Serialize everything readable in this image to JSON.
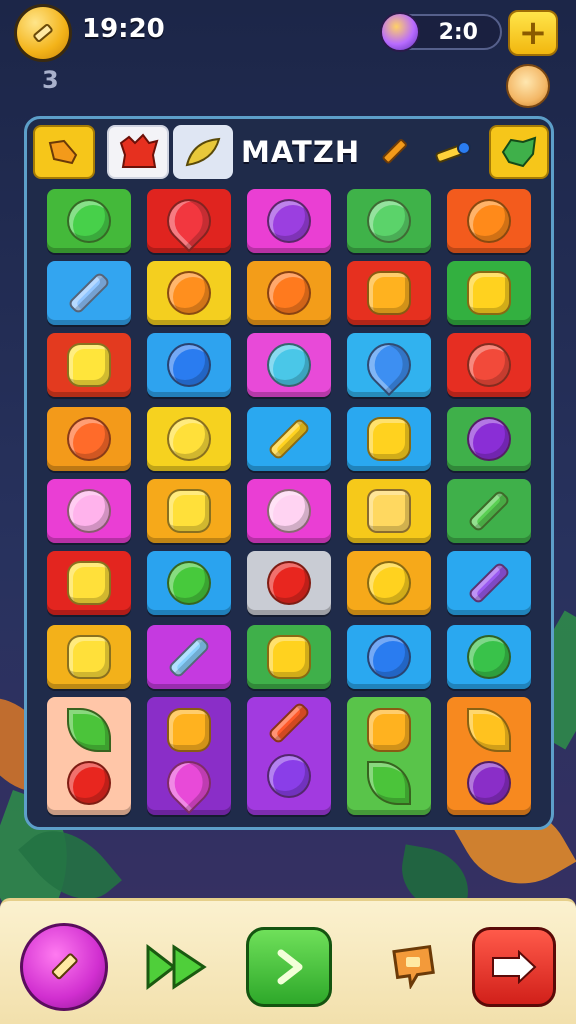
{
  "hud": {
    "time": "19:20",
    "level": "3",
    "score": "2:0",
    "plus_label": "+"
  },
  "board": {
    "title": "MATZH",
    "tab_icons": [
      "boot-icon",
      "red-monster-icon",
      "leaf-icon",
      "pencil-icon",
      "telescope-icon",
      "green-leaf-icon"
    ],
    "rows": [
      [
        {
          "bg": "#44b93a",
          "icon": "green-ball-icon",
          "c": "#47d04a"
        },
        {
          "bg": "#e0241f",
          "icon": "heart-icon",
          "c": "#f2373f"
        },
        {
          "bg": "#ea3fd3",
          "icon": "planet-icon",
          "c": "#9b3fe0"
        },
        {
          "bg": "#3fb249",
          "icon": "green-creature-icon",
          "c": "#5bd36a"
        },
        {
          "bg": "#f35b1d",
          "icon": "orange-icon",
          "c": "#ff8a1a"
        }
      ],
      [
        {
          "bg": "#33a5f0",
          "icon": "potion-icon",
          "c": "#8fc5ff"
        },
        {
          "bg": "#f4cf1f",
          "icon": "orange-icon",
          "c": "#ff8f1e"
        },
        {
          "bg": "#f39d19",
          "icon": "orange-icon",
          "c": "#ff7a1e"
        },
        {
          "bg": "#e6301f",
          "icon": "sun-face-icon",
          "c": "#ffb21f"
        },
        {
          "bg": "#33b040",
          "icon": "star-burst-icon",
          "c": "#ffd21f"
        }
      ],
      [
        {
          "bg": "#e33a1f",
          "icon": "star-face-icon",
          "c": "#ffe53b"
        },
        {
          "bg": "#2ea3ef",
          "icon": "blue-ball-icon",
          "c": "#2a7cf0"
        },
        {
          "bg": "#e84ad8",
          "icon": "teapot-icon",
          "c": "#4ac7e8"
        },
        {
          "bg": "#31b2ef",
          "icon": "blue-heart-icon",
          "c": "#3d8ff2"
        },
        {
          "bg": "#e62e22",
          "icon": "red-monster-icon",
          "c": "#f24a3a"
        }
      ],
      [
        {
          "bg": "#f39a1a",
          "icon": "orange-monster-icon",
          "c": "#ff6b2a"
        },
        {
          "bg": "#f6d21f",
          "icon": "lemon-icon",
          "c": "#ffe03a"
        },
        {
          "bg": "#2aa8f0",
          "icon": "pencil-icon",
          "c": "#ffd21f"
        },
        {
          "bg": "#2aa8f0",
          "icon": "sun-face-icon",
          "c": "#ffd21f"
        },
        {
          "bg": "#3fb04a",
          "icon": "purple-ball-icon",
          "c": "#8a2ed6"
        }
      ],
      [
        {
          "bg": "#ea3ed4",
          "icon": "pink-cat-icon",
          "c": "#ffb3ec"
        },
        {
          "bg": "#f6a91a",
          "icon": "star-icon",
          "c": "#ffe03a"
        },
        {
          "bg": "#ea3ed4",
          "icon": "pink-cat-icon",
          "c": "#ffd3f2"
        },
        {
          "bg": "#f6c91a",
          "icon": "toast-icon",
          "c": "#ffd860"
        },
        {
          "bg": "#3fb04a",
          "icon": "green-pencil-icon",
          "c": "#5ad053"
        }
      ],
      [
        {
          "bg": "#e3251f",
          "icon": "star-face-icon",
          "c": "#ffe03a"
        },
        {
          "bg": "#2aa3ef",
          "icon": "green-apple-icon",
          "c": "#47c93c"
        },
        {
          "bg": "#c9ccd4",
          "icon": "apple-icon",
          "c": "#e8261f"
        },
        {
          "bg": "#f6a91a",
          "icon": "yellow-ball-icon",
          "c": "#ffd21f"
        },
        {
          "bg": "#2aa8f0",
          "icon": "purple-pencil-icon",
          "c": "#9a5af0"
        }
      ],
      [
        {
          "bg": "#f3b11a",
          "icon": "sun-face-icon",
          "c": "#ffe03a"
        },
        {
          "bg": "#c53ae0",
          "icon": "sword-icon",
          "c": "#8ad2ff"
        },
        {
          "bg": "#3fb04a",
          "icon": "star-burst-icon",
          "c": "#ffd21f"
        },
        {
          "bg": "#2aa8f0",
          "icon": "blue-ball-icon",
          "c": "#2a7cf0"
        },
        {
          "bg": "#2aa8f0",
          "icon": "swirl-icon",
          "c": "#39c24a"
        }
      ],
      [
        {
          "bg": "#ffc6a8",
          "icon": "leaf-icon",
          "c": "#4bc43a",
          "icon2": "apple-icon",
          "c2": "#e8261f"
        },
        {
          "bg": "#8a2ec8",
          "icon": "star-burst-icon",
          "c": "#ffb21f",
          "icon2": "heart-icon",
          "c2": "#e84ad8"
        },
        {
          "bg": "#a23ae0",
          "icon": "carrot-icon",
          "c": "#ff5a2a",
          "icon2": "plum-icon",
          "c2": "#8a3ee8"
        },
        {
          "bg": "#59c44a",
          "icon": "star-burst-icon",
          "c": "#ffb21f",
          "icon2": "leaf-icon",
          "c2": "#4bc43a"
        },
        {
          "bg": "#f7891f",
          "icon": "leaf-icon",
          "c": "#ffc21f",
          "icon2": "eggplant-icon",
          "c2": "#8a2ec8"
        }
      ]
    ]
  },
  "bottom": {
    "buttons": [
      "pencil-button",
      "fast-forward-button",
      "play-button",
      "hint-button",
      "back-button"
    ]
  }
}
